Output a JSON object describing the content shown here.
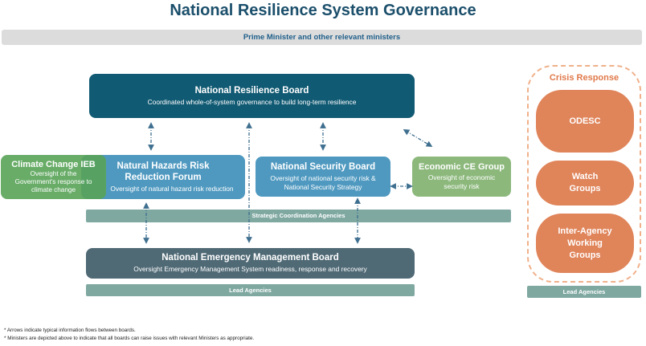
{
  "title": "National Resilience System Governance",
  "ministers_bar": "Prime Minister and other relevant ministers",
  "national_resilience_board": {
    "title": "National Resilience Board",
    "subtitle": "Coordinated whole-of-system governance to build long-term resilience"
  },
  "climate_change_ieb": {
    "title": "Climate Change IEB",
    "subtitle_lines": [
      "Oversight of the",
      "Government's response to",
      "climate change"
    ]
  },
  "natural_hazards_forum": {
    "title_lines": [
      "Natural Hazards Risk",
      "Reduction Forum"
    ],
    "subtitle": "Oversight of natural hazard risk reduction"
  },
  "national_security_board": {
    "title": "National Security Board",
    "subtitle_lines": [
      "Oversight of  national security risk &",
      "National Security Strategy"
    ]
  },
  "economic_ce_group": {
    "title": "Economic CE Group",
    "subtitle_lines": [
      "Oversight of  economic",
      "security risk"
    ]
  },
  "strategic_coordination_bar": "Strategic Coordination Agencies",
  "national_emergency_board": {
    "title": "National Emergency Management Board",
    "subtitle": "Oversight Emergency Management System readiness, response and recovery"
  },
  "lead_agencies_main": "Lead Agencies",
  "crisis_response": {
    "title": "Crisis Response",
    "odesc": "ODESC",
    "watch_groups_lines": [
      "Watch",
      "Groups"
    ],
    "iawg_lines": [
      "Inter-Agency",
      "Working",
      "Groups"
    ],
    "lead_agencies": "Lead Agencies"
  },
  "footnotes": [
    "* Arrows indicate typical information flows between boards.",
    "* Ministers are depicted above to indicate that all boards can raise issues with relevant Ministers as appropriate."
  ],
  "colors": {
    "title": "#1b4f6b",
    "dark_teal": "#115a73",
    "mid_blue": "#4f99c0",
    "green": "#58a358",
    "light_green": "#8cb87c",
    "slate": "#4f6975",
    "sage": "#7fa8a1",
    "orange": "#e0845a",
    "arrow": "#3f6f8f"
  },
  "arrow_style": "dash-dot, double-headed"
}
